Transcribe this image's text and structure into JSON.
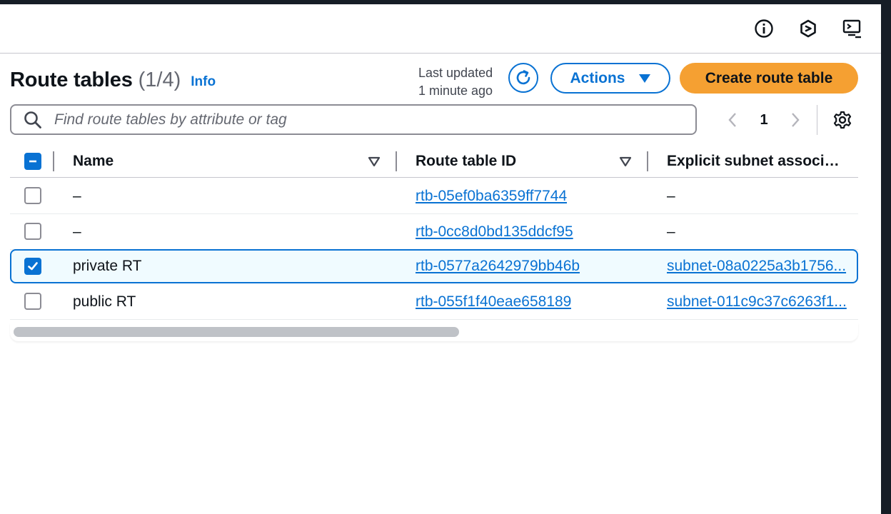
{
  "header_icons": [
    {
      "name": "info-circle-icon"
    },
    {
      "name": "cloudshell-hex-icon"
    },
    {
      "name": "remote-console-icon"
    }
  ],
  "page": {
    "title": "Route tables",
    "count": "(1/4)",
    "info": "Info",
    "last_updated_line1": "Last updated",
    "last_updated_line2": "1 minute ago",
    "actions_label": "Actions",
    "create_label": "Create route table"
  },
  "search": {
    "placeholder": "Find route tables by attribute or tag",
    "value": ""
  },
  "pagination": {
    "current_page": "1"
  },
  "table": {
    "columns": [
      "Name",
      "Route table ID",
      "Explicit subnet associ…"
    ],
    "rows": [
      {
        "checked": false,
        "name": "–",
        "id": "rtb-05ef0ba6359ff7744",
        "subnet": "–"
      },
      {
        "checked": false,
        "name": "–",
        "id": "rtb-0cc8d0bd135ddcf95",
        "subnet": "–"
      },
      {
        "checked": true,
        "name": "private RT",
        "id": "rtb-0577a2642979bb46b",
        "subnet": "subnet-08a0225a3b1756..."
      },
      {
        "checked": false,
        "name": "public RT",
        "id": "rtb-055f1f40eae658189",
        "subnet": "subnet-011c9c37c6263f1..."
      }
    ]
  },
  "colors": {
    "accent": "#0972d3",
    "primary_button": "#f5a032",
    "top_bar": "#161d26"
  }
}
